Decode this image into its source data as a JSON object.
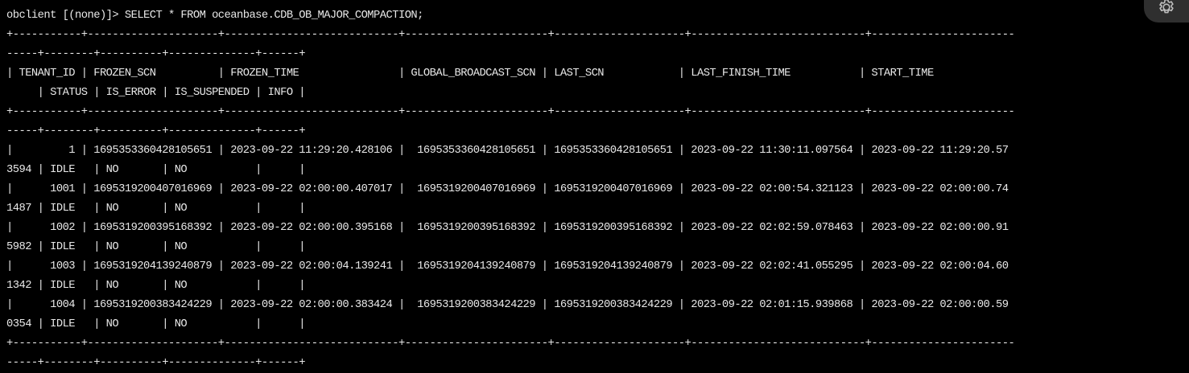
{
  "terminal": {
    "lines": [
      "obclient [(none)]> SELECT * FROM oceanbase.CDB_OB_MAJOR_COMPACTION;",
      "+-----------+---------------------+----------------------------+-----------------------+---------------------+----------------------------+-----------------------",
      "-----+--------+----------+--------------+------+",
      "| TENANT_ID | FROZEN_SCN          | FROZEN_TIME                | GLOBAL_BROADCAST_SCN | LAST_SCN            | LAST_FINISH_TIME           | START_TIME",
      "     | STATUS | IS_ERROR | IS_SUSPENDED | INFO |",
      "+-----------+---------------------+----------------------------+-----------------------+---------------------+----------------------------+-----------------------",
      "-----+--------+----------+--------------+------+",
      "|         1 | 1695353360428105651 | 2023-09-22 11:29:20.428106 |  1695353360428105651 | 1695353360428105651 | 2023-09-22 11:30:11.097564 | 2023-09-22 11:29:20.57",
      "3594 | IDLE   | NO       | NO           |      |",
      "|      1001 | 1695319200407016969 | 2023-09-22 02:00:00.407017 |  1695319200407016969 | 1695319200407016969 | 2023-09-22 02:00:54.321123 | 2023-09-22 02:00:00.74",
      "1487 | IDLE   | NO       | NO           |      |",
      "|      1002 | 1695319200395168392 | 2023-09-22 02:00:00.395168 |  1695319200395168392 | 1695319200395168392 | 2023-09-22 02:02:59.078463 | 2023-09-22 02:00:00.91",
      "5982 | IDLE   | NO       | NO           |      |",
      "|      1003 | 1695319204139240879 | 2023-09-22 02:00:04.139241 |  1695319204139240879 | 1695319204139240879 | 2023-09-22 02:02:41.055295 | 2023-09-22 02:00:04.60",
      "1342 | IDLE   | NO       | NO           |      |",
      "|      1004 | 1695319200383424229 | 2023-09-22 02:00:00.383424 |  1695319200383424229 | 1695319200383424229 | 2023-09-22 02:01:15.939868 | 2023-09-22 02:00:00.59",
      "0354 | IDLE   | NO       | NO           |      |",
      "+-----------+---------------------+----------------------------+-----------------------+---------------------+----------------------------+-----------------------",
      "-----+--------+----------+--------------+------+"
    ]
  },
  "settings_icon": "gear-icon",
  "colors": {
    "background": "#000000",
    "text": "#e8e8e8",
    "button_background": "#2f2f2f",
    "icon": "#bdbdbd"
  }
}
